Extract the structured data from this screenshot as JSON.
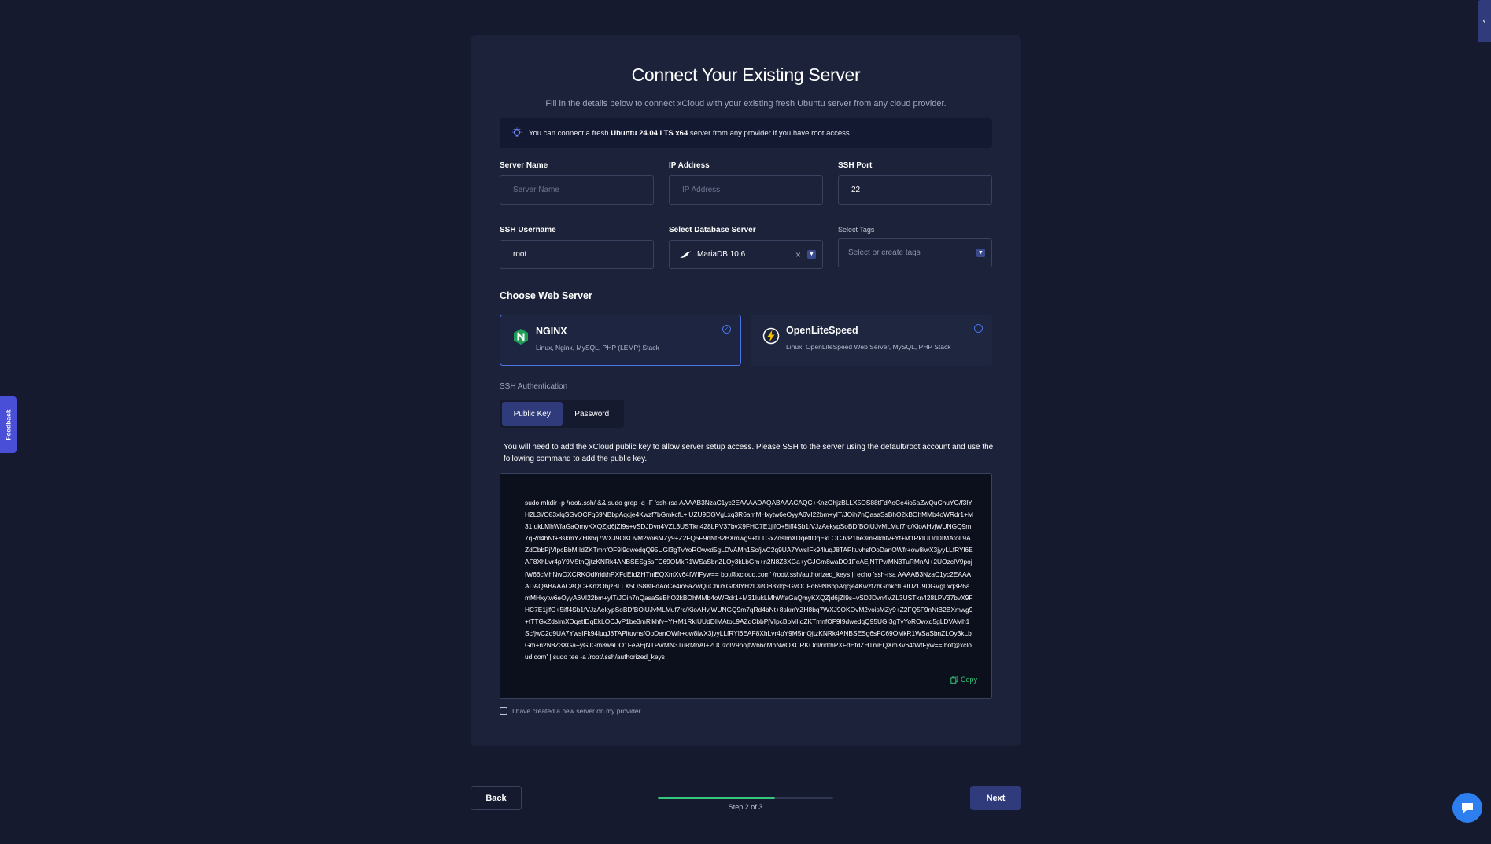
{
  "page": {
    "title": "Connect Your Existing Server",
    "subtitle": "Fill in the details below to connect xCloud with your existing fresh Ubuntu server from any cloud provider."
  },
  "notice": {
    "prefix": "You can connect a fresh",
    "highlight": "Ubuntu 24.04 LTS x64",
    "suffix": "server from any provider if you have root access."
  },
  "form": {
    "server_name": {
      "label": "Server Name",
      "placeholder": "Server Name",
      "value": ""
    },
    "ip_address": {
      "label": "IP Address",
      "placeholder": "IP Address",
      "value": ""
    },
    "ssh_port": {
      "label": "SSH Port",
      "value": "22"
    },
    "ssh_username": {
      "label": "SSH Username",
      "value": "root"
    },
    "database_server": {
      "label": "Select Database Server",
      "value": "MariaDB 10.6"
    },
    "tags": {
      "label": "Select Tags",
      "placeholder": "Select or create tags"
    }
  },
  "web_server": {
    "title": "Choose Web Server",
    "options": [
      {
        "name": "NGINX",
        "description": "Linux, Nginx, MySQL, PHP (LEMP) Stack",
        "selected": true
      },
      {
        "name": "OpenLiteSpeed",
        "description": "Linux, OpenLiteSpeed Web Server, MySQL, PHP Stack",
        "selected": false
      }
    ]
  },
  "ssh_auth": {
    "label": "SSH Authentication",
    "tabs": [
      "Public Key",
      "Password"
    ],
    "active_tab": "Public Key",
    "instructions": "You will need to add the xCloud public key to allow server setup access. Please SSH to the server using the default/root account and use the following command to add the public key.",
    "command": "sudo mkdir -p /root/.ssh/ && sudo grep -q -F 'ssh-rsa AAAAB3NzaC1yc2EAAAADAQABAAACAQC+KnzOhjzBLLX5OS88tFdAoCe4io5aZwQuChuYG/f3lYH2L3i/O83xlqSGvOCFq69NBbpAqcje4Kwzf7bGmkcfL+lUZU9DGVgLxq3R6amMHxytw6eOyyA6VI22bm+yIT/JOih7nQasaSsBhO2kBOhMMb4oWRdr1+M31IukLMhWfaGaQmyKXQZjd6jZI9s+vSDJDvn4VZL3USTkn428LPV37bvX9FHC7E1jlfO+5iff4Sb1fVJzAekypSoBDfBOiUJvMLMuf7rc/KioAHvjWUNGQ9m7qRd4bNt+8skmYZH8bq7WXJ9OKOvM2voisMZy9+Z2FQ5F9nNtB2BXmwg9+tTTGxZdslmXDqetIDqEkLOCJvP1be3mRlkhfv+Yf+M1RkIUUdDIMAtoL9AZdCbbPjVIpcBbMIIdZKTmnfOF9I9dwedqQ95UGI3gTvYoROwxd5gLDVAMh1Sc/jwC2q9UA7YwsIFk94luqJ8TAPltuvhsfOoDanOWfr+ow8iwX3jyyLLfRYl6EAF8XhLvr4pY9M5tnQjtzKNRk4ANBSESg6sFC69OMkR1WSaSbnZLOy3kLbGm+n2N8Z3XGa+yGJGm8waDO1FeAEjNTPv/MN3TuRMnAI+2UOzcIV9pojfW66cMhNwOXCRKOdl/ridthPXFdEfdZHTniEQXmXv64fWfFyw== bot@xcloud.com' /root/.ssh/authorized_keys || echo 'ssh-rsa AAAAB3NzaC1yc2EAAAADAQABAAACAQC+KnzOhjzBLLX5OS88tFdAoCe4io5aZwQuChuYG/f3lYH2L3i/O83xlqSGvOCFq69NBbpAqcje4Kwzf7bGmkcfL+lUZU9DGVgLxq3R6amMHxytw6eOyyA6VI22bm+yIT/JOih7nQasaSsBhO2kBOhMMb4oWRdr1+M31IukLMhWfaGaQmyKXQZjd6jZI9s+vSDJDvn4VZL3USTkn428LPV37bvX9FHC7E1jlfO+5iff4Sb1fVJzAekypSoBDfBOiUJvMLMuf7rc/KioAHvjWUNGQ9m7qRd4bNt+8skmYZH8bq7WXJ9OKOvM2voisMZy9+Z2FQ5F9nNtB2BXmwg9+tTTGxZdslmXDqetIDqEkLOCJvP1be3mRlkhfv+Yf+M1RkIUUdDIMAtoL9AZdCbbPjVIpcBbMIIdZKTmnfOF9I9dwedqQ95UGI3gTvYoROwxd5gLDVAMh1Sc/jwC2q9UA7YwsIFk94luqJ8TAPltuvhsfOoDanOWfr+ow8iwX3jyyLLfRYl6EAF8XhLvr4pY9M5tnQjtzKNRk4ANBSESg6sFC69OMkR1WSaSbnZLOy3kLbGm+n2N8Z3XGa+yGJGm8waDO1FeAEjNTPv/MN3TuRMnAI+2UOzcIV9pojfW66cMhNwOXCRKOdl/ridthPXFdEfdZHTniEQXmXv64fWfFyw== bot@xcloud.com' | sudo tee -a /root/.ssh/authorized_keys",
    "copy_label": "Copy"
  },
  "confirm_checkbox": {
    "label": "I have created a new server on my provider",
    "checked": false
  },
  "footer": {
    "back_label": "Back",
    "next_label": "Next",
    "step_label": "Step 2 of 3",
    "progress": 0.667
  },
  "feedback_label": "Feedback",
  "colors": {
    "background": "#151a2f",
    "card": "#1c2239",
    "accent": "#2f3b7a",
    "selected_border": "#4a74e8",
    "progress": "#34c77b"
  },
  "icons": {
    "notice": "lightbulb-icon",
    "nginx": "nginx-logo-icon",
    "openlitespeed": "openlitespeed-logo-icon",
    "database": "mariadb-seal-icon",
    "copy": "copy-icon",
    "chat": "chat-bubble-icon",
    "collapse": "chevron-left-icon"
  }
}
